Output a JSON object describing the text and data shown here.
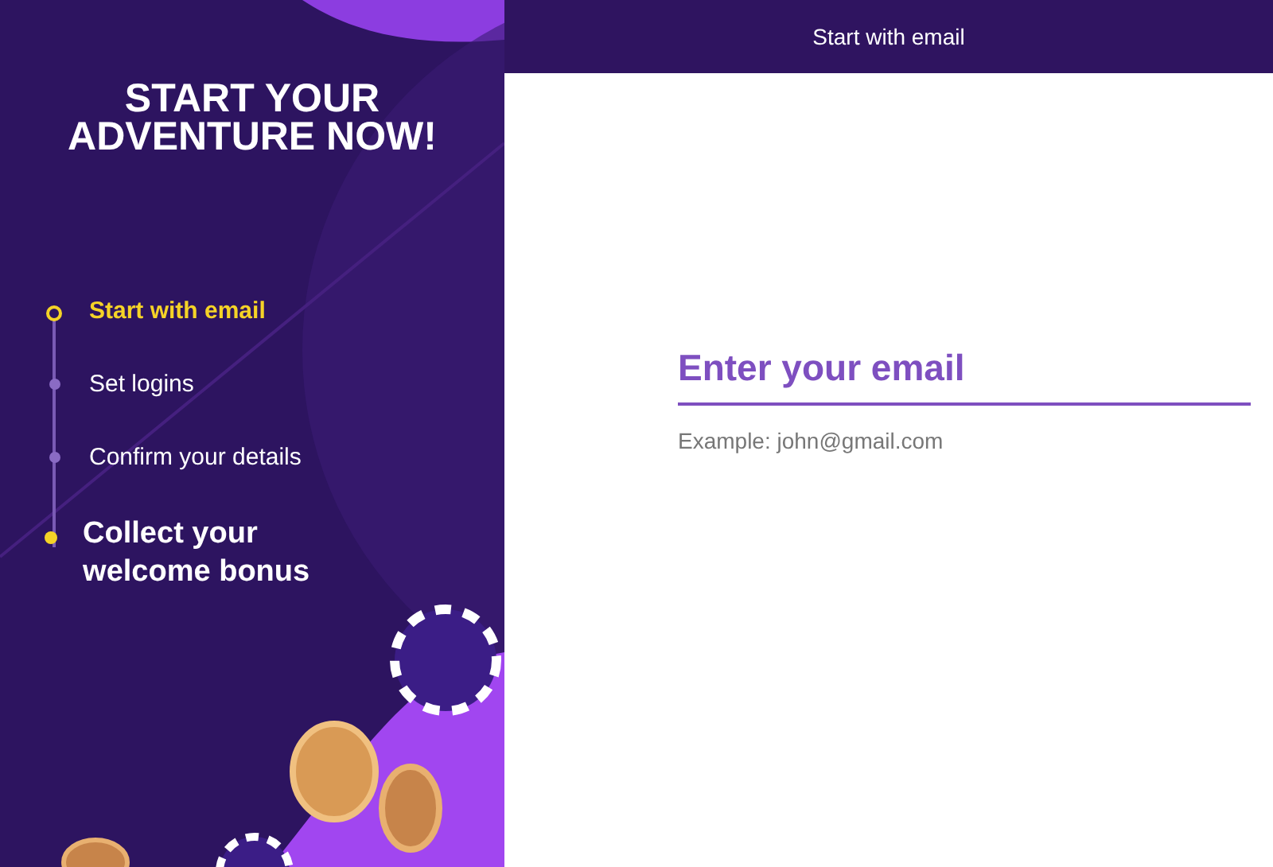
{
  "sidebar": {
    "heading": "START YOUR ADVENTURE NOW!",
    "steps": [
      {
        "label": "Start with email",
        "selected": true,
        "emphasized": false
      },
      {
        "label": "Set logins",
        "selected": false,
        "emphasized": false
      },
      {
        "label": "Confirm your details",
        "selected": false,
        "emphasized": false
      },
      {
        "label": "Collect your welcome bonus",
        "selected": false,
        "emphasized": true
      }
    ]
  },
  "header": {
    "title": "Start with email"
  },
  "email_field": {
    "placeholder": "Enter your email",
    "hint": "Example: john@gmail.com"
  }
}
